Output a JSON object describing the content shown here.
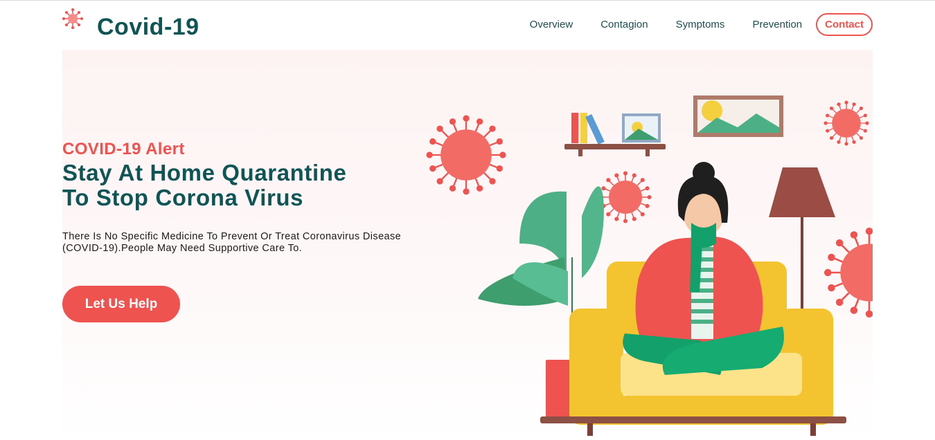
{
  "header": {
    "brand": "Covid-19",
    "logo_icon": "virus-icon",
    "nav": {
      "overview": "Overview",
      "contagion": "Contagion",
      "symptoms": "Symptoms",
      "prevention": "Prevention",
      "contact": "Contact"
    }
  },
  "hero": {
    "alert": "COVID-19 Alert",
    "headline_line1": "Stay At Home Quarantine",
    "headline_line2": "To Stop Corona Virus",
    "description": "There Is No Specific Medicine To Prevent Or Treat Coronavirus Disease (COVID-19).People May Need Supportive Care To.",
    "cta": "Let Us Help",
    "illustration": "woman-quarantine-sofa-illustration"
  },
  "colors": {
    "accent": "#ef5350",
    "brand": "#0f5556",
    "plant": "#4caf86",
    "sofa": "#f4c430"
  }
}
